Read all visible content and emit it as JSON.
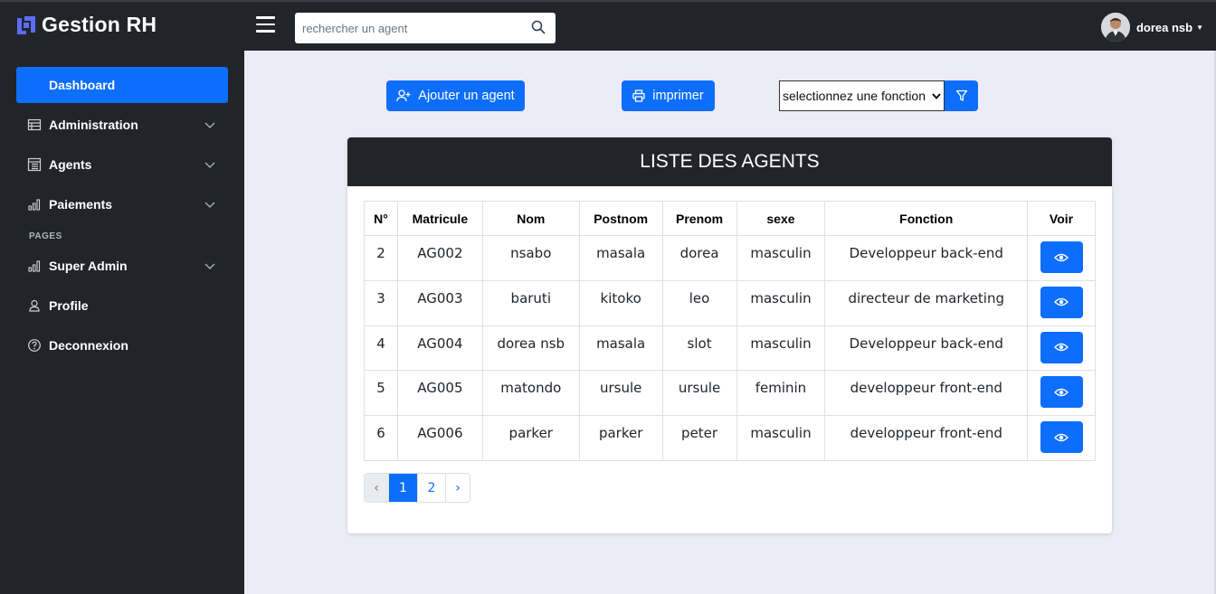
{
  "app": {
    "title": "Gestion RH"
  },
  "search": {
    "placeholder": "rechercher un agent"
  },
  "user": {
    "name": "dorea nsb"
  },
  "sidebar": {
    "items": [
      {
        "label": "Dashboard",
        "icon": "dashboard-icon"
      },
      {
        "label": "Administration",
        "icon": "list-icon"
      },
      {
        "label": "Agents",
        "icon": "table-icon"
      },
      {
        "label": "Paiements",
        "icon": "bar-chart-icon"
      },
      {
        "label": "Super Admin",
        "icon": "bar-chart-icon"
      },
      {
        "label": "Profile",
        "icon": "user-icon"
      },
      {
        "label": "Deconnexion",
        "icon": "question-circle-icon"
      }
    ],
    "section_label": "PAGES"
  },
  "toolbar": {
    "add_label": "Ajouter un agent",
    "print_label": "imprimer",
    "select_value": "selectionnez une fonction"
  },
  "table": {
    "title": "LISTE DES AGENTS",
    "columns": [
      "N°",
      "Matricule",
      "Nom",
      "Postnom",
      "Prenom",
      "sexe",
      "Fonction",
      "Voir"
    ],
    "rows": [
      [
        "2",
        "AG002",
        "nsabo",
        "masala",
        "dorea",
        "masculin",
        "Developpeur back-end"
      ],
      [
        "3",
        "AG003",
        "baruti",
        "kitoko",
        "leo",
        "masculin",
        "directeur de marketing"
      ],
      [
        "4",
        "AG004",
        "dorea nsb",
        "masala",
        "slot",
        "masculin",
        "Developpeur back-end"
      ],
      [
        "5",
        "AG005",
        "matondo",
        "ursule",
        "ursule",
        "feminin",
        "developpeur front-end"
      ],
      [
        "6",
        "AG006",
        "parker",
        "parker",
        "peter",
        "masculin",
        "developpeur front-end"
      ]
    ]
  },
  "pagination": {
    "prev": "‹",
    "pages": [
      "1",
      "2"
    ],
    "next": "›",
    "current": "1"
  },
  "colors": {
    "primary": "#0d6efd",
    "dark": "#212529",
    "background": "#ececf7"
  }
}
